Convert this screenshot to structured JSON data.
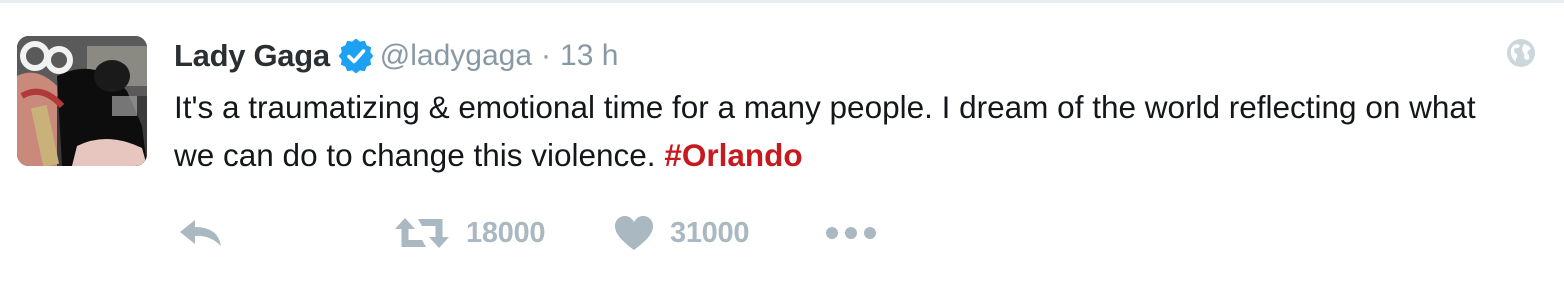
{
  "tweet": {
    "author": {
      "name": "Lady Gaga",
      "handle": "@ladygaga",
      "verified": true
    },
    "separator": "·",
    "time": "13 h",
    "text": "It's a traumatizing & emotional time for a many people. I dream of the world reflecting on what we can do to change this violence. ",
    "hashtag": "#Orlando",
    "actions": {
      "retweet_count": "18000",
      "like_count": "31000"
    }
  },
  "colors": {
    "name": "#292f33",
    "meta": "#8899a6",
    "text": "#14171a",
    "hashtag": "#c71a1e",
    "action_gray": "#aab8c2",
    "verified_blue": "#1da1f2"
  },
  "icons": {
    "verified": "verified-badge-icon",
    "globe": "globe-icon",
    "reply": "reply-icon",
    "retweet": "retweet-icon",
    "like": "heart-icon",
    "more": "more-icon"
  }
}
